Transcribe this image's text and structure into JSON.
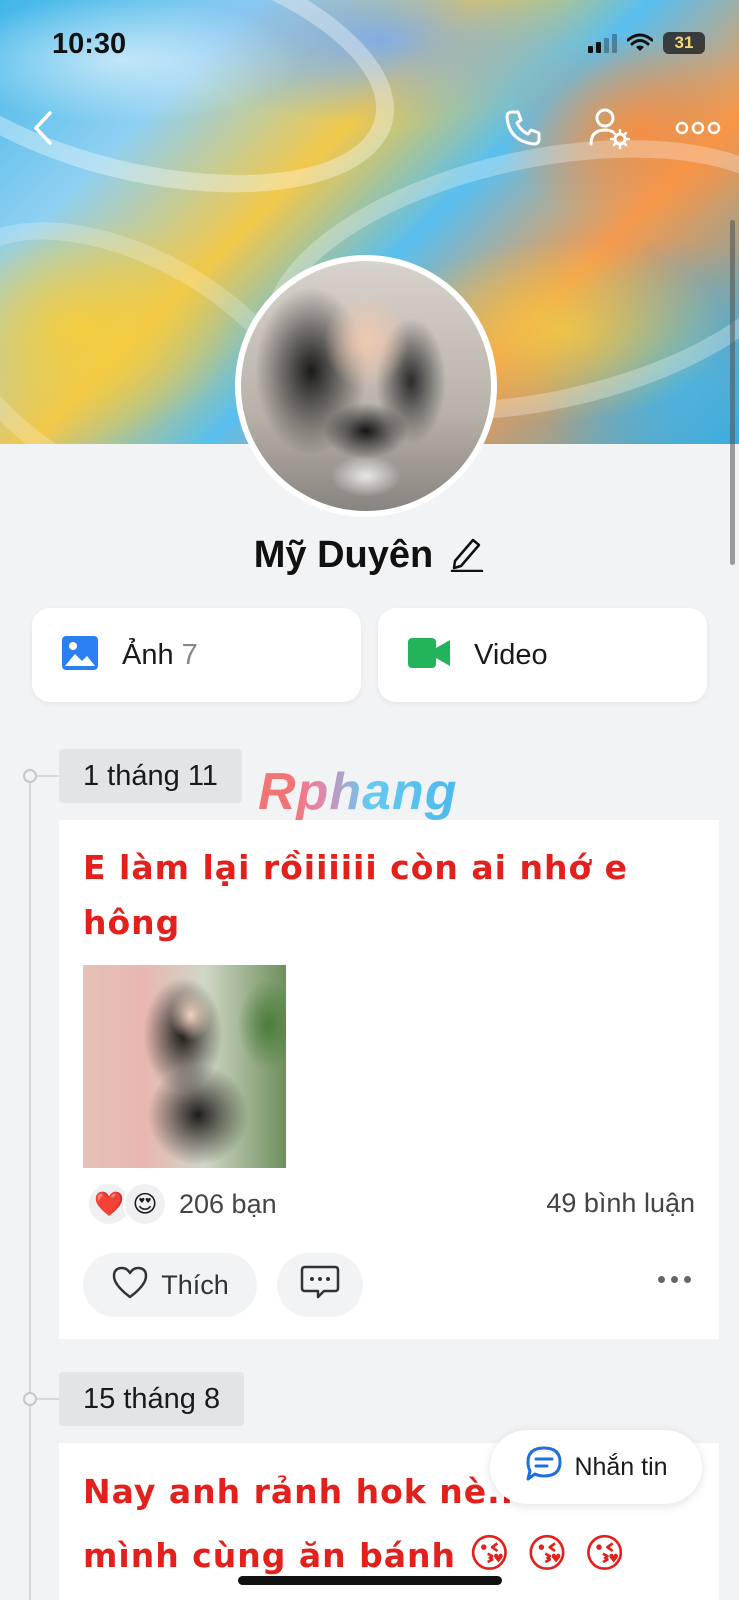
{
  "status_bar": {
    "time": "10:30",
    "battery": "31"
  },
  "profile": {
    "name": "Mỹ Duyên"
  },
  "media_tabs": [
    {
      "label": "Ảnh",
      "count": "7"
    },
    {
      "label": "Video"
    }
  ],
  "watermark": "Rphang",
  "posts": [
    {
      "date": "1 tháng 11",
      "text_line1": "E làm lại rồiiiiii còn ai nhớ e",
      "text_line2": "hông",
      "reaction_icons": [
        "❤️",
        "😍"
      ],
      "reaction_count": "206 bạn",
      "comment_count": "49 bình luận",
      "like_label": "Thích"
    },
    {
      "date": "15 tháng 8",
      "text_line1": "Nay anh rảnh hok nè...",
      "text_line2": "mình cùng ăn bánh",
      "emojis": "😘 😘 😘"
    }
  ],
  "message_button": {
    "label": "Nhắn tin"
  },
  "colors": {
    "post_text": "#e3201b",
    "photo_icon": "#2b7ff0",
    "video_icon": "#23b35a",
    "message_icon": "#1f6fe0"
  },
  "icons": {
    "back": "back-chevron-icon",
    "call": "phone-icon",
    "settings": "user-settings-icon",
    "more": "more-horizontal-icon",
    "edit": "pencil-icon",
    "photo": "image-icon",
    "video": "video-camera-icon",
    "like": "heart-outline-icon",
    "comment": "comment-bubble-icon",
    "message": "chat-bubble-icon"
  }
}
